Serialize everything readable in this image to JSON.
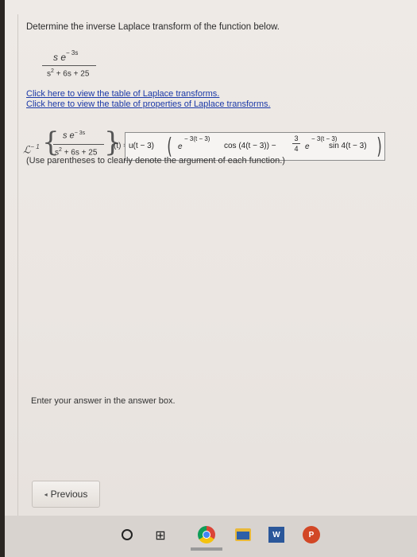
{
  "problem": {
    "prompt": "Determine the inverse Laplace transform of the function below.",
    "function": {
      "numerator_base": "s e",
      "numerator_exp": "− 3s",
      "denominator_s": "s",
      "denominator_exp": "2",
      "denominator_rest": "+ 6s + 25"
    },
    "links": {
      "table_transforms": "Click here to view the table of Laplace transforms.",
      "table_properties": "Click here to view the table of properties of Laplace transforms."
    }
  },
  "answer": {
    "operator": "ℒ",
    "operator_exp": "− 1",
    "inner_num_base": "s e",
    "inner_num_exp": "− 3s",
    "inner_den_s": "s",
    "inner_den_exp": "2",
    "inner_den_rest": "+ 6s + 25",
    "t_eq": "(t) =",
    "step": "u(t − 3)",
    "e1": "e",
    "exp1": "− 3(t − 3)",
    "cos_term": "cos (4(t − 3)) −",
    "coef_num": "3",
    "coef_den": "4",
    "e2": "e",
    "exp2": "− 3(t − 3)",
    "sin_term": "sin 4(t − 3)"
  },
  "note": "(Use parentheses to clearly denote the argument of each function.)",
  "footer": {
    "instruction": "Enter your answer in the answer box.",
    "previous_label": "Previous"
  },
  "taskbar": {
    "word_label": "W",
    "ppt_label": "P"
  }
}
